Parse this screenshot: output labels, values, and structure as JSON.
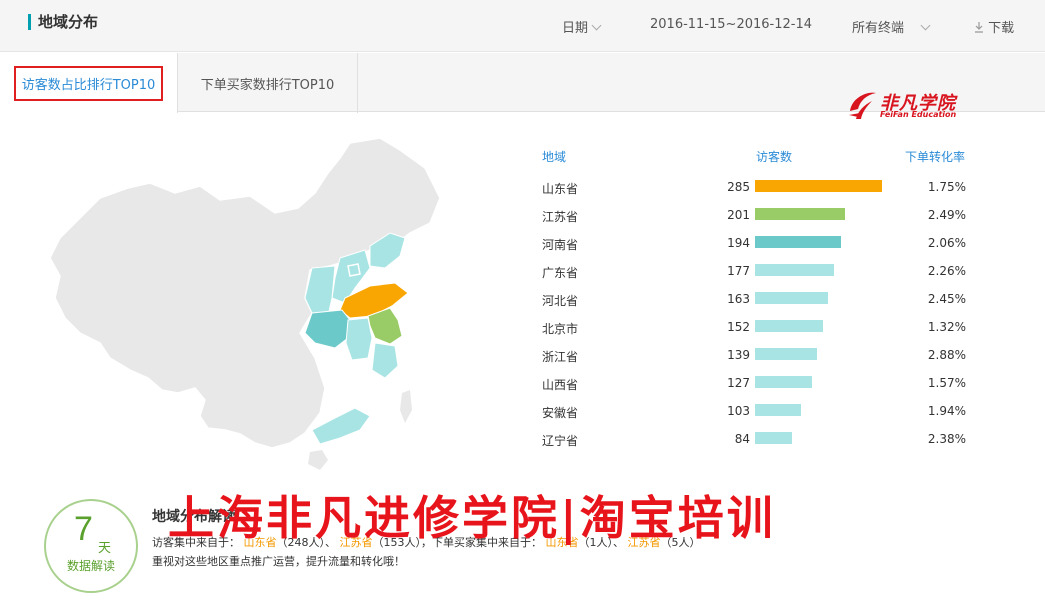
{
  "header": {
    "title": "地域分布",
    "date_label": "日期",
    "date_range": "2016-11-15~2016-12-14",
    "terminal_label": "所有终端",
    "download_label": "下载"
  },
  "tabs": [
    {
      "label": "访客数占比排行TOP10",
      "active": true
    },
    {
      "label": "下单买家数排行TOP10",
      "active": false
    }
  ],
  "logo": {
    "zh": "非凡学院",
    "en": "FeiFan Education"
  },
  "table": {
    "headers": {
      "region": "地域",
      "visitors": "访客数",
      "conversion": "下单转化率"
    },
    "rows": [
      {
        "province": "山东省",
        "visitors": "285",
        "visitors_value": 285,
        "rate": "1.75%",
        "bar_color": "#f9a602"
      },
      {
        "province": "江苏省",
        "visitors": "201",
        "visitors_value": 201,
        "rate": "2.49%",
        "bar_color": "#99cc66"
      },
      {
        "province": "河南省",
        "visitors": "194",
        "visitors_value": 194,
        "rate": "2.06%",
        "bar_color": "#6cc9c9"
      },
      {
        "province": "广东省",
        "visitors": "177",
        "visitors_value": 177,
        "rate": "2.26%",
        "bar_color": "#a8e4e4"
      },
      {
        "province": "河北省",
        "visitors": "163",
        "visitors_value": 163,
        "rate": "2.45%",
        "bar_color": "#a8e4e4"
      },
      {
        "province": "北京市",
        "visitors": "152",
        "visitors_value": 152,
        "rate": "1.32%",
        "bar_color": "#a8e4e4"
      },
      {
        "province": "浙江省",
        "visitors": "139",
        "visitors_value": 139,
        "rate": "2.88%",
        "bar_color": "#a8e4e4"
      },
      {
        "province": "山西省",
        "visitors": "127",
        "visitors_value": 127,
        "rate": "1.57%",
        "bar_color": "#a8e4e4"
      },
      {
        "province": "安徽省",
        "visitors": "103",
        "visitors_value": 103,
        "rate": "1.94%",
        "bar_color": "#a8e4e4"
      },
      {
        "province": "辽宁省",
        "visitors": "84",
        "visitors_value": 84,
        "rate": "2.38%",
        "bar_color": "#a8e4e4"
      }
    ]
  },
  "interpretation": {
    "badge_number": "7",
    "badge_unit": "天",
    "badge_label": "数据解读",
    "title": "地域分布解读",
    "line1_prefix": "访客集中来自于：",
    "visitor_top1": "山东省",
    "visitor_top1_count": "（248人）、",
    "visitor_top2": "江苏省",
    "visitor_top2_count": "（153人）",
    "line1_mid": "，下单买家集中来自于：",
    "buyer_top1": "山东省",
    "buyer_top1_count": "（1人）、",
    "buyer_top2": "江苏省",
    "buyer_top2_count": "（5人）",
    "line2": "重视对这些地区重点推广运营，提升流量和转化哦！"
  },
  "watermark": "上海非凡进修学院|淘宝培训",
  "colors": {
    "accent": "#2a8bd6",
    "highlight": "#f39800",
    "map_base": "#e8e8e8",
    "watermark": "#e8141b"
  }
}
